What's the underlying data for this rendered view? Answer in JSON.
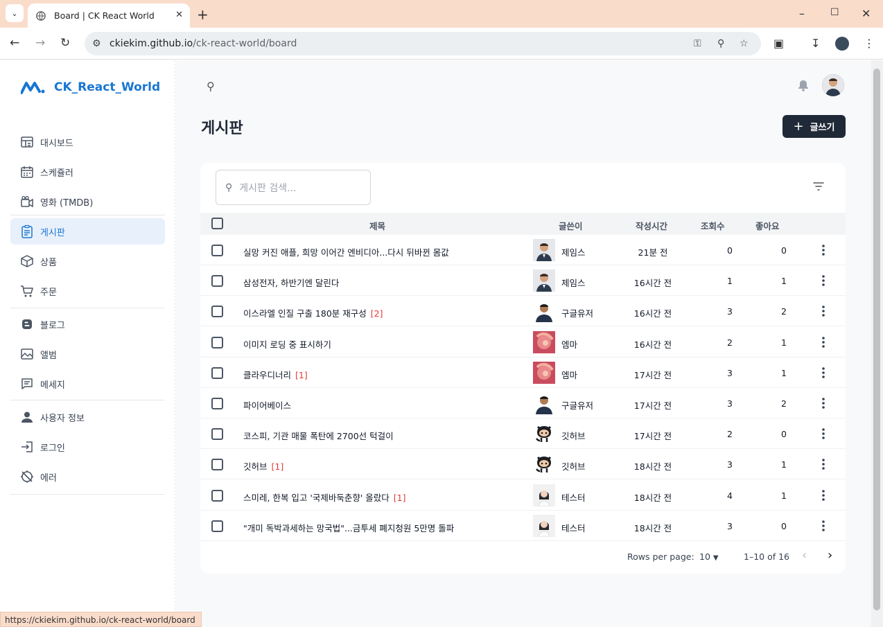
{
  "browser": {
    "tab_title": "Board | CK React World",
    "url_host": "ckiekim.github.io",
    "url_path": "/ck-react-world/board",
    "status_url": "https://ckiekim.github.io/ck-react-world/board"
  },
  "app": {
    "name": "CK_React_World",
    "accent_color": "#1976d2"
  },
  "sidebar": {
    "groups": [
      [
        {
          "label": "대시보드",
          "icon": "dashboard-icon"
        },
        {
          "label": "스케쥴러",
          "icon": "calendar-icon"
        },
        {
          "label": "영화 (TMDB)",
          "icon": "video-camera-icon"
        }
      ],
      [
        {
          "label": "게시판",
          "icon": "clipboard-icon",
          "active": true
        },
        {
          "label": "상품",
          "icon": "box-icon"
        },
        {
          "label": "주문",
          "icon": "cart-icon"
        }
      ],
      [
        {
          "label": "블로그",
          "icon": "blogger-icon"
        },
        {
          "label": "앨범",
          "icon": "image-icon"
        },
        {
          "label": "메세지",
          "icon": "message-icon"
        }
      ],
      [
        {
          "label": "사용자 정보",
          "icon": "user-icon"
        },
        {
          "label": "로그인",
          "icon": "login-icon"
        },
        {
          "label": "에러",
          "icon": "error-icon"
        }
      ]
    ]
  },
  "page": {
    "title": "게시판",
    "write_button": "글쓰기"
  },
  "table": {
    "search_placeholder": "게시판 검색...",
    "columns": {
      "title": "제목",
      "author": "글쓴이",
      "time": "작성시간",
      "views": "조회수",
      "likes": "좋아요"
    },
    "rows": [
      {
        "title": "실망 커진 애플, 희망 이어간 엔비디아...다시 뒤바뀐 몸값",
        "comments": "",
        "author": "제임스",
        "avatar": "james",
        "time": "21분 전",
        "views": "0",
        "likes": "0"
      },
      {
        "title": "삼성전자, 하반기엔 달린다",
        "comments": "",
        "author": "제임스",
        "avatar": "james",
        "time": "16시간 전",
        "views": "1",
        "likes": "1"
      },
      {
        "title": "이스라엘 인질 구출 180분 재구성",
        "comments": "[2]",
        "author": "구글유저",
        "avatar": "google",
        "time": "16시간 전",
        "views": "3",
        "likes": "2"
      },
      {
        "title": "이미지 로딩 중 표시하기",
        "comments": "",
        "author": "엠마",
        "avatar": "emma",
        "time": "16시간 전",
        "views": "2",
        "likes": "1"
      },
      {
        "title": "클라우디너리",
        "comments": "[1]",
        "author": "엠마",
        "avatar": "emma",
        "time": "17시간 전",
        "views": "3",
        "likes": "1"
      },
      {
        "title": "파이어베이스",
        "comments": "",
        "author": "구글유저",
        "avatar": "google",
        "time": "17시간 전",
        "views": "3",
        "likes": "2"
      },
      {
        "title": "코스피, 기관 매물 폭탄에 2700선 턱걸이",
        "comments": "",
        "author": "깃허브",
        "avatar": "github",
        "time": "17시간 전",
        "views": "2",
        "likes": "0"
      },
      {
        "title": "깃허브",
        "comments": "[1]",
        "author": "깃허브",
        "avatar": "github",
        "time": "18시간 전",
        "views": "3",
        "likes": "1"
      },
      {
        "title": "스미레, 한복 입고 '국제바둑춘향' 올랐다",
        "comments": "[1]",
        "author": "테스터",
        "avatar": "tester",
        "time": "18시간 전",
        "views": "4",
        "likes": "1"
      },
      {
        "title": "\"개미 독박과세하는 망국법\"...금투세 폐지청원 5만명 돌파",
        "comments": "",
        "author": "테스터",
        "avatar": "tester",
        "time": "18시간 전",
        "views": "3",
        "likes": "0"
      }
    ]
  },
  "pagination": {
    "rows_per_page_label": "Rows per page:",
    "rows_per_page": "10",
    "range": "1–10 of 16"
  }
}
